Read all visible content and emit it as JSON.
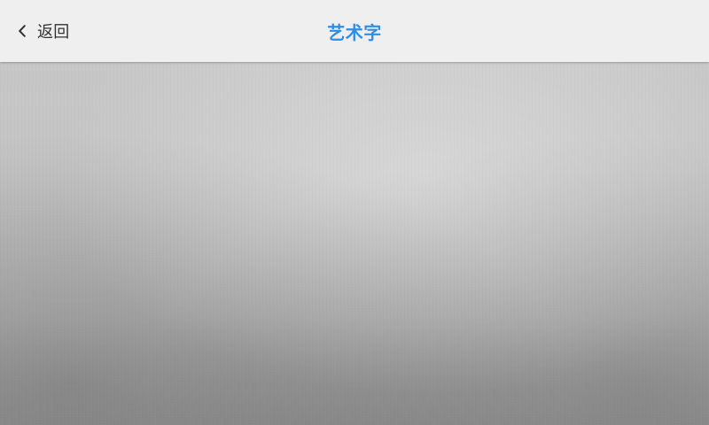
{
  "header": {
    "back_label": "返回",
    "title": "艺术字",
    "back_icon": "chevron-left-icon"
  },
  "colors": {
    "title": "#2f8de4",
    "back_text": "#333333",
    "topbar_bg": "#efefef"
  }
}
